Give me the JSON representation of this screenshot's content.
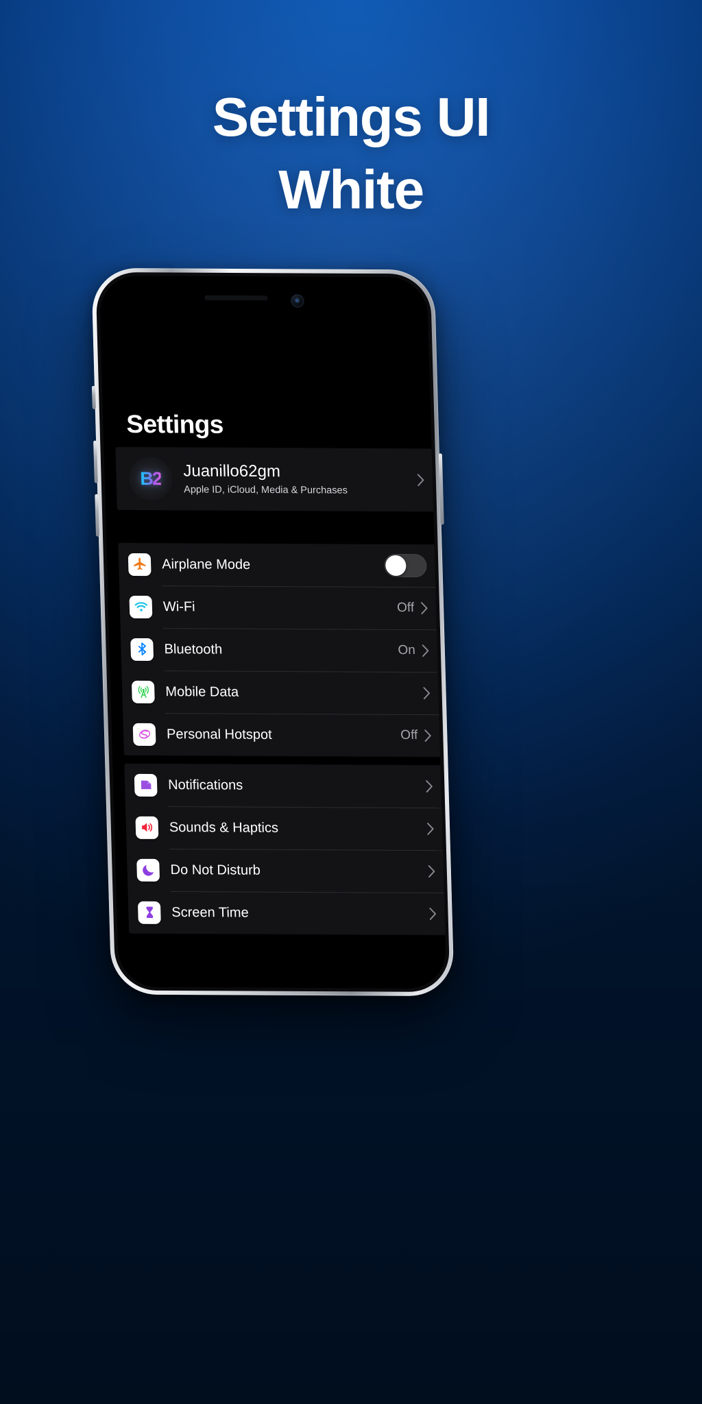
{
  "background": {
    "gradient_from": "#0a57b4",
    "gradient_to": "#01152e"
  },
  "promo": {
    "headline_line1": "Settings UI",
    "headline_line2": "White",
    "headline_color": "#ffffff"
  },
  "phone": {
    "frame_color": "#d8dade",
    "screen_background": "#000000"
  },
  "settings": {
    "page_title": "Settings",
    "account": {
      "avatar_initials": "B2",
      "name": "Juanillo62gm",
      "subtitle": "Apple ID, iCloud, Media & Purchases",
      "chevron": "›"
    },
    "groups": [
      {
        "id": "connectivity",
        "rows": [
          {
            "icon": "airplane-icon",
            "icon_color": "#f07815",
            "label": "Airplane Mode",
            "value": "",
            "control": "toggle",
            "toggle_on": false
          },
          {
            "icon": "wifi-icon",
            "icon_color": "#18c2e8",
            "label": "Wi-Fi",
            "value": "Off",
            "control": "chevron"
          },
          {
            "icon": "bluetooth-icon",
            "icon_color": "#0a84ff",
            "label": "Bluetooth",
            "value": "On",
            "control": "chevron"
          },
          {
            "icon": "antenna-icon",
            "icon_color": "#2ad04a",
            "label": "Mobile Data",
            "value": "",
            "control": "chevron"
          },
          {
            "icon": "hotspot-icon",
            "icon_color": "#d658e0",
            "label": "Personal Hotspot",
            "value": "Off",
            "control": "chevron"
          }
        ]
      },
      {
        "id": "alerts",
        "rows": [
          {
            "icon": "notifications-icon",
            "icon_color": "#9b4fe0",
            "label": "Notifications",
            "value": "",
            "control": "chevron"
          },
          {
            "icon": "sounds-icon",
            "icon_color": "#f4243a",
            "label": "Sounds & Haptics",
            "value": "",
            "control": "chevron"
          },
          {
            "icon": "moon-icon",
            "icon_color": "#8e3fe0",
            "label": "Do Not Disturb",
            "value": "",
            "control": "chevron"
          },
          {
            "icon": "hourglass-icon",
            "icon_color": "#8e3fe0",
            "label": "Screen Time",
            "value": "",
            "control": "chevron"
          }
        ]
      }
    ]
  }
}
